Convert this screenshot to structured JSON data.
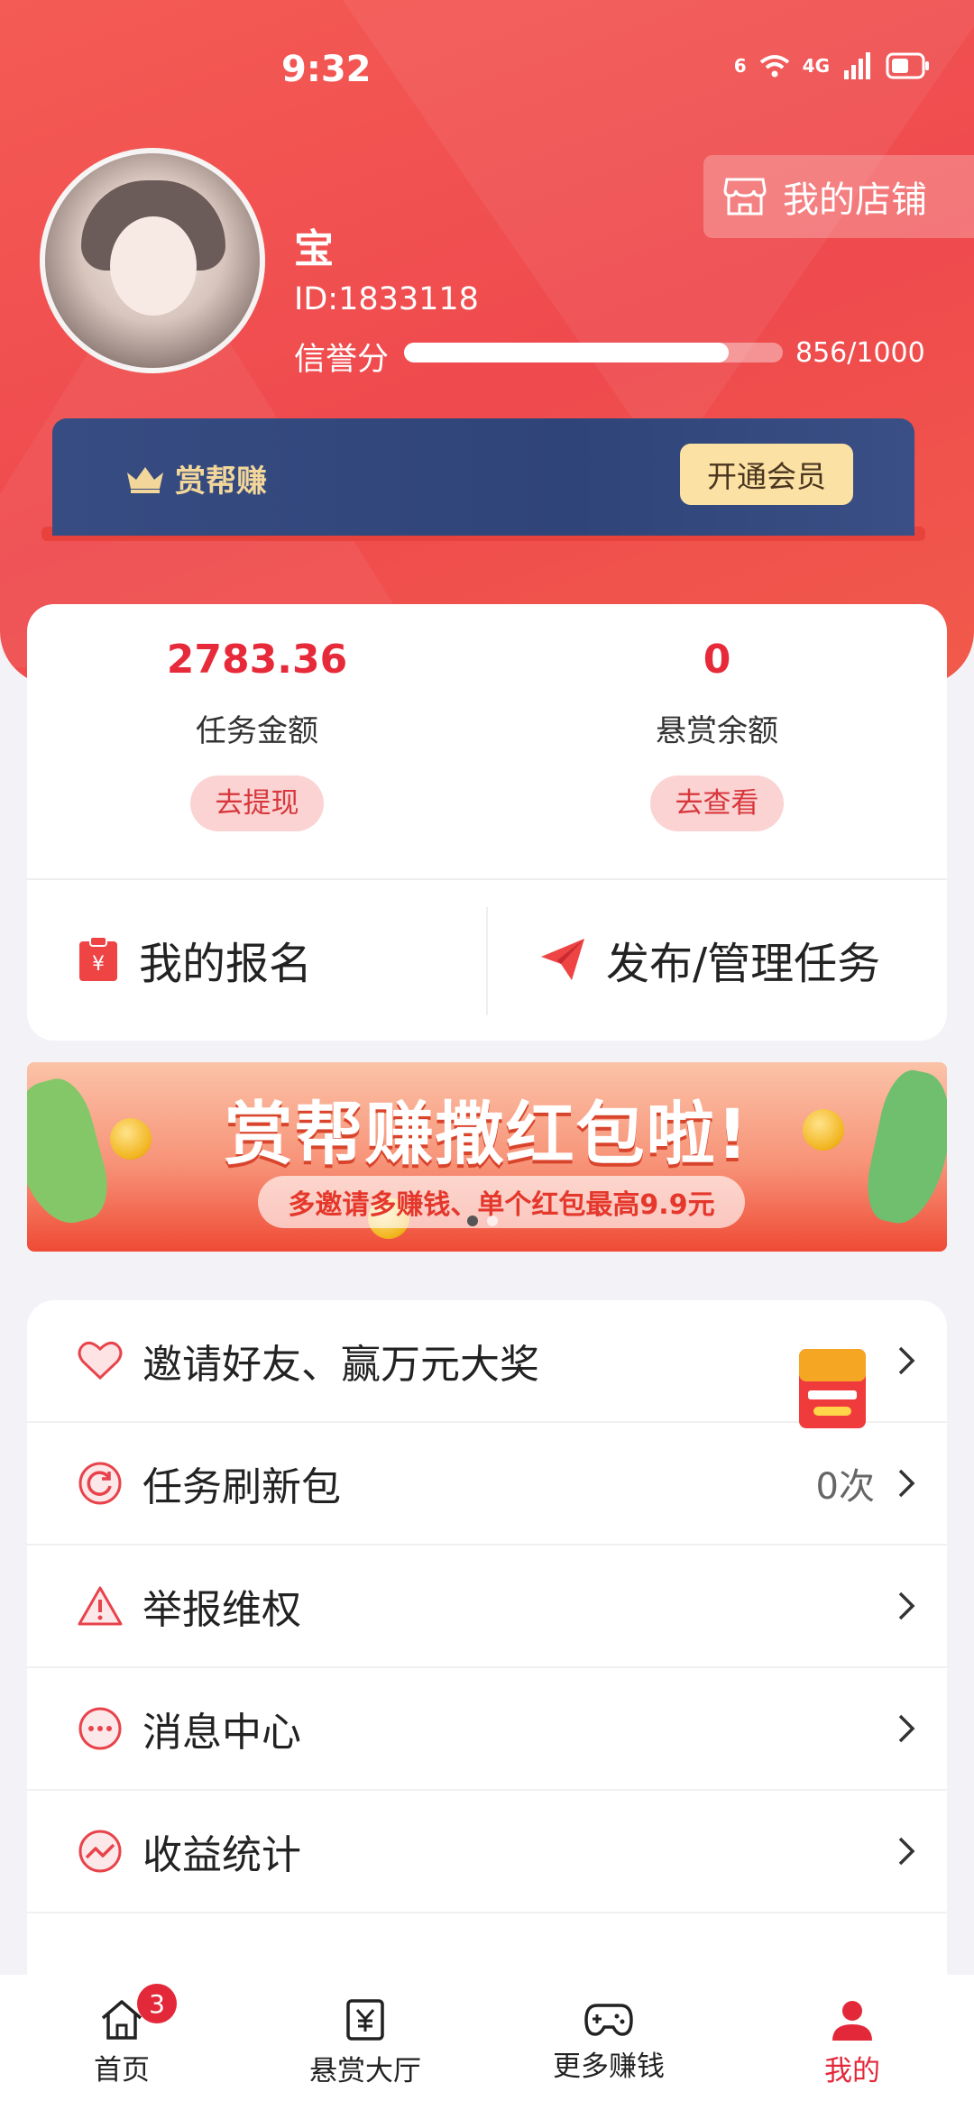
{
  "status_bar": {
    "time": "9:32",
    "wifi_label": "6",
    "network_label": "4G"
  },
  "profile": {
    "shop_label": "我的店铺",
    "username": "宝",
    "id_text": "ID:1833118",
    "credit_label": "信誉分",
    "credit_value_text": "856/1000",
    "credit_fraction": 0.856
  },
  "vip": {
    "brand": "赏帮赚",
    "open_label": "开通会员"
  },
  "wallet": {
    "task_amount": "2783.36",
    "task_amount_label": "任务金额",
    "withdraw_label": "去提现",
    "bounty_balance": "0",
    "bounty_balance_label": "悬赏余额",
    "view_label": "去查看",
    "my_signup_label": "我的报名",
    "publish_label": "发布/管理任务"
  },
  "banner": {
    "title": "赏帮赚撒红包啦!",
    "subtitle": "多邀请多赚钱、单个红包最高9.9元"
  },
  "menu": {
    "items": [
      {
        "label": "邀请好友、赢万元大奖",
        "icon": "heart-icon",
        "value": ""
      },
      {
        "label": "任务刷新包",
        "icon": "refresh-icon",
        "value": "0次"
      },
      {
        "label": "举报维权",
        "icon": "warning-icon",
        "value": ""
      },
      {
        "label": "消息中心",
        "icon": "message-icon",
        "value": ""
      },
      {
        "label": "收益统计",
        "icon": "stats-icon",
        "value": ""
      }
    ]
  },
  "tabbar": {
    "tabs": [
      {
        "label": "首页",
        "icon": "home-icon",
        "badge": "3"
      },
      {
        "label": "悬赏大厅",
        "icon": "bounty-icon"
      },
      {
        "label": "更多赚钱",
        "icon": "gamepad-icon"
      },
      {
        "label": "我的",
        "icon": "profile-icon"
      }
    ],
    "active_index": 3
  },
  "colors": {
    "primary": "#ef4a4e",
    "amount": "#e72a3a",
    "vip_bg": "#374c82",
    "vip_gold": "#f3d79a"
  }
}
